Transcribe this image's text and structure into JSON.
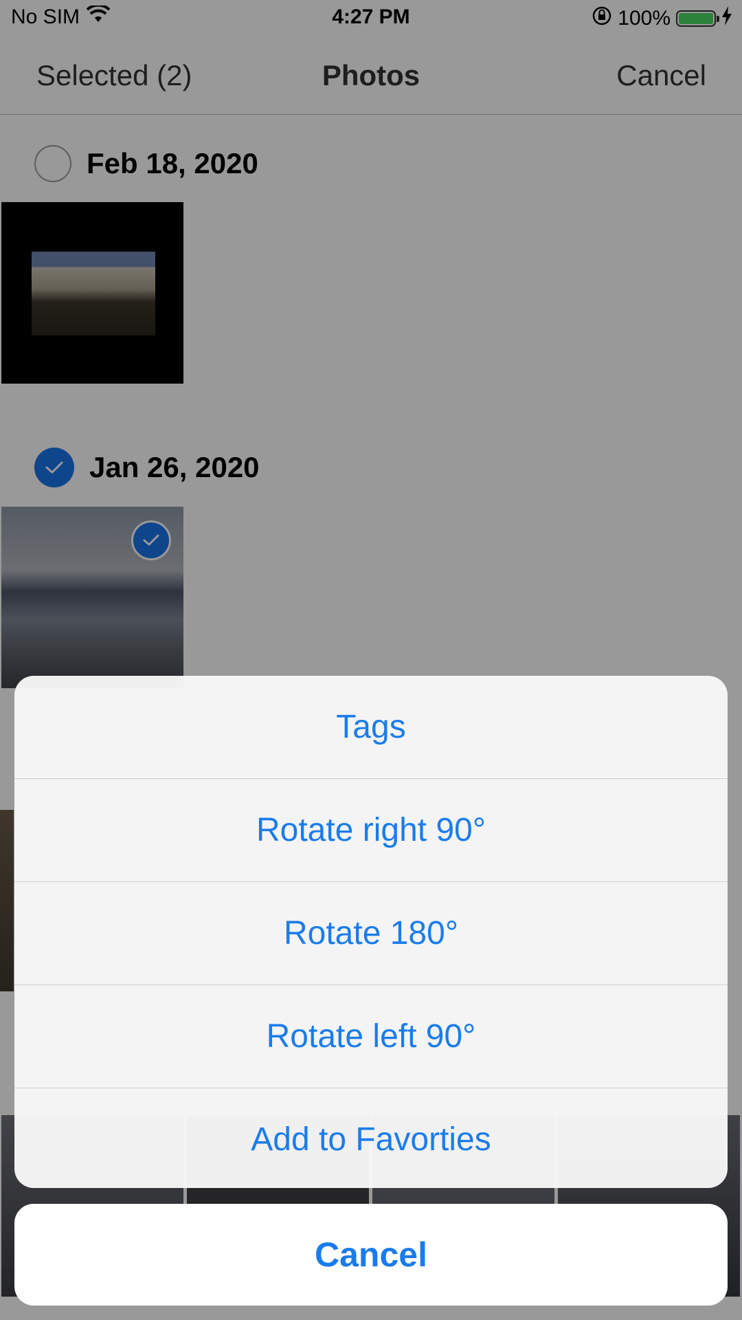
{
  "status_bar": {
    "carrier": "No SIM",
    "time": "4:27 PM",
    "battery": "100%"
  },
  "nav": {
    "left": "Selected (2)",
    "title": "Photos",
    "right": "Cancel"
  },
  "sections": [
    {
      "date": "Feb 18, 2020",
      "selected": false
    },
    {
      "date": "Jan 26, 2020",
      "selected": true
    }
  ],
  "action_sheet": {
    "items": [
      "Tags",
      "Rotate right 90°",
      "Rotate 180°",
      "Rotate left 90°",
      "Add to Favorties"
    ],
    "cancel": "Cancel"
  },
  "colors": {
    "accent": "#1a7ceb",
    "selection": "#1a73e8",
    "battery": "#4cd964"
  }
}
